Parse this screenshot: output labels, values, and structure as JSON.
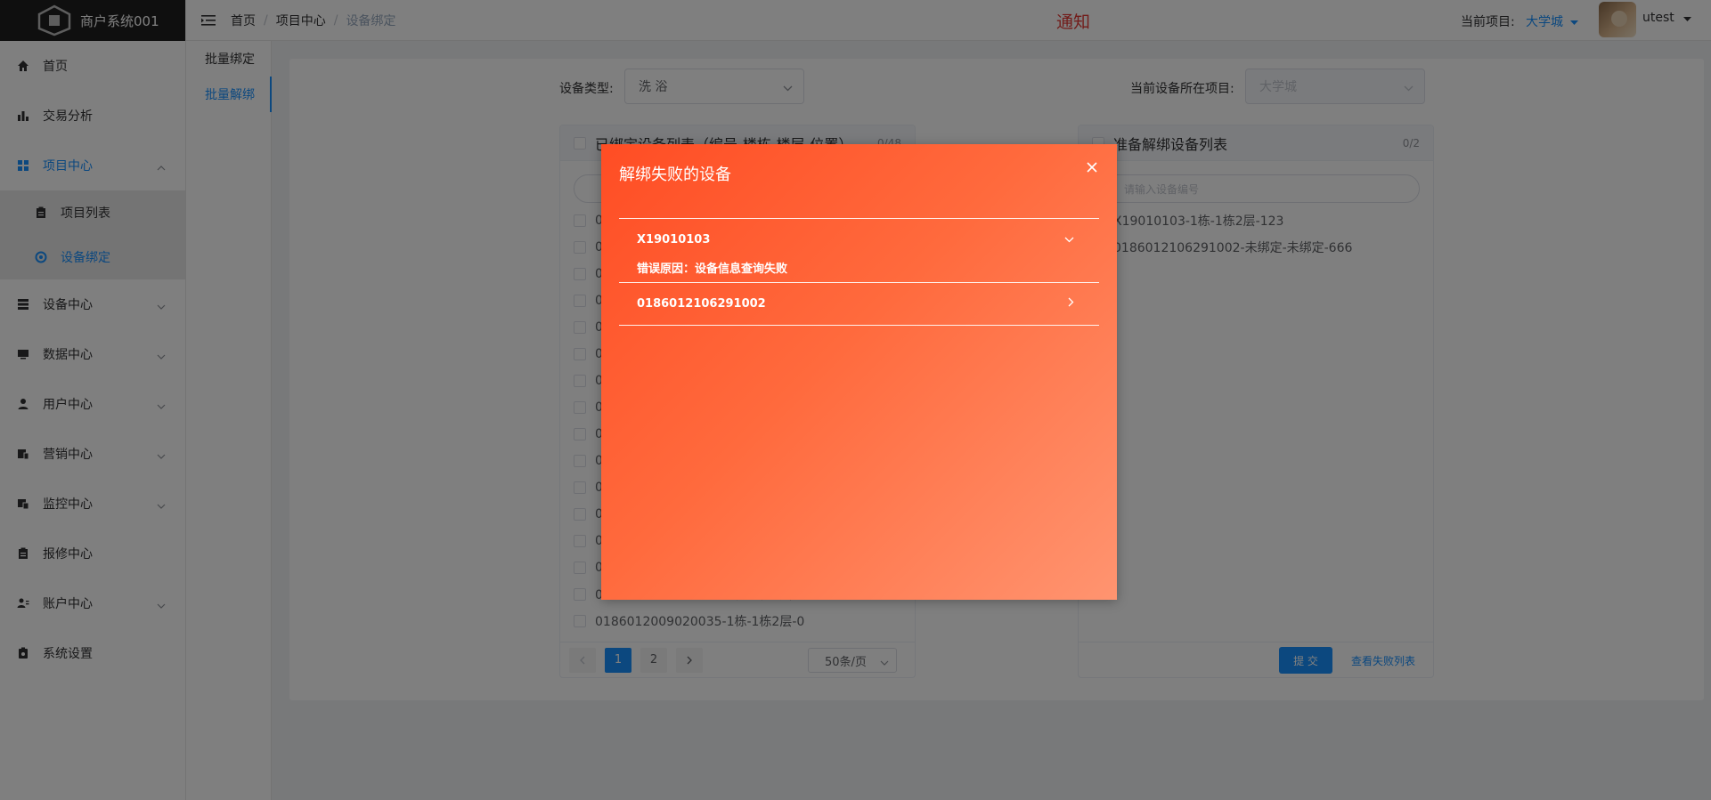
{
  "app": {
    "title": "商户系统001"
  },
  "sidebar": {
    "items": [
      {
        "label": "首页",
        "icon": "home-icon"
      },
      {
        "label": "交易分析",
        "icon": "bar-chart-icon"
      },
      {
        "label": "项目中心",
        "icon": "grid-icon",
        "expanded": true
      },
      {
        "label": "设备中心",
        "icon": "list-icon"
      },
      {
        "label": "数据中心",
        "icon": "monitor-icon"
      },
      {
        "label": "用户中心",
        "icon": "user-icon"
      },
      {
        "label": "营销中心",
        "icon": "marketing-icon"
      },
      {
        "label": "监控中心",
        "icon": "monitor-cam-icon"
      },
      {
        "label": "报修中心",
        "icon": "clipboard-icon"
      },
      {
        "label": "账户中心",
        "icon": "account-icon"
      },
      {
        "label": "系统设置",
        "icon": "settings-icon"
      }
    ],
    "subitems": [
      {
        "label": "项目列表",
        "icon": "clipboard-icon"
      },
      {
        "label": "设备绑定",
        "icon": "bind-icon",
        "active": true
      }
    ]
  },
  "header": {
    "breadcrumb": [
      "首页",
      "项目中心",
      "设备绑定"
    ],
    "notice": "通知",
    "project_label": "当前项目:",
    "project_value": "大学城",
    "username": "utest"
  },
  "tabs": [
    {
      "label": "批量绑定"
    },
    {
      "label": "批量解绑",
      "active": true
    }
  ],
  "form": {
    "device_type_label": "设备类型:",
    "device_type_value": "洗 浴",
    "current_project_label": "当前设备所在项目:",
    "current_project_value": "大学城"
  },
  "left_panel": {
    "title": "已绑定设备列表（编号-楼栋-楼层-位置）",
    "count": "0/48",
    "rows": [
      "0",
      "0",
      "0",
      "0",
      "0",
      "0",
      "0",
      "0",
      "0",
      "0",
      "0",
      "0",
      "0",
      "0",
      "0186012009020040-1栋-1栋2层-0",
      "0186012009020035-1栋-1栋2层-0"
    ],
    "pages": [
      "1",
      "2"
    ],
    "page_size": "50条/页"
  },
  "right_panel": {
    "title": "准备解绑设备列表",
    "count": "0/2",
    "search_placeholder": "请输入设备编号",
    "rows": [
      "X19010103-1栋-1栋2层-123",
      "0186012106291002-未绑定-未绑定-666"
    ],
    "submit_label": "提 交",
    "fail_link": "查看失败列表"
  },
  "dialog": {
    "title": "解绑失败的设备",
    "items": [
      {
        "id": "X19010103",
        "expanded": true,
        "reason": "错误原因：设备信息查询失败"
      },
      {
        "id": "0186012106291002",
        "expanded": false
      }
    ]
  },
  "colors": {
    "accent": "#1890ff",
    "dialog_start": "#ff4d24",
    "dialog_end": "#ff9470",
    "notice": "#e53935"
  }
}
